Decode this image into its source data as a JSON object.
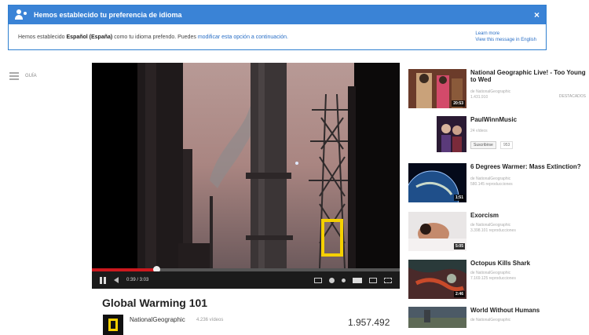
{
  "lang_banner": {
    "heading": "Hemos establecido tu preferencia de idioma",
    "close": "×",
    "body_prefix": "Hemos establecido",
    "body_language": "Español (España)",
    "body_middle": "como tu idioma prefendo. Puedes",
    "body_link": "modificar esta opción a continuación.",
    "learn_more": "Learn more",
    "view_english": "View this message in English"
  },
  "guide": {
    "label": "GUÍA"
  },
  "player": {
    "time": "0:39 / 3:03",
    "progress": 0.21
  },
  "video": {
    "title": "Global Warming 101",
    "channel": "NationalGeographic",
    "channel_videos": "4.236 vídeos",
    "views": "1.957.492"
  },
  "sidebar": [
    {
      "title": "National Geographic Live! - Too Young to Wed",
      "byline": "de NationalGeographic",
      "views": "1.431.910",
      "badge": "DESTACADOS",
      "duration": "20:53"
    },
    {
      "title": "PaulWinnMusic",
      "byline": "24 vídeos",
      "subscribe": "Suscribirse",
      "sub_count": "953"
    },
    {
      "title": "6 Degrees Warmer: Mass Extinction?",
      "byline": "de NationalGeographic",
      "views": "580.145 reproducciones",
      "duration": "1:51"
    },
    {
      "title": "Exorcism",
      "byline": "de NationalGeographic",
      "views": "3.398.101 reproducciones",
      "duration": "5:05"
    },
    {
      "title": "Octopus Kills Shark",
      "byline": "de NationalGeographic",
      "views": "7.169.125 reproducciones",
      "duration": "2:46"
    },
    {
      "title": "World Without Humans",
      "byline": "de NationalGeographic"
    }
  ],
  "colors": {
    "banner_blue": "#3a83d6",
    "progress_red": "#cc181e",
    "link_blue": "#2a6fc6",
    "natgeo_yellow": "#f5d000"
  },
  "icons": [
    "user-language-icon",
    "close-icon",
    "guide-menu-icon",
    "pause-icon",
    "volume-icon",
    "captions-icon",
    "settings-icon",
    "annotations-icon",
    "small-player-icon",
    "large-player-icon",
    "fullscreen-icon"
  ]
}
